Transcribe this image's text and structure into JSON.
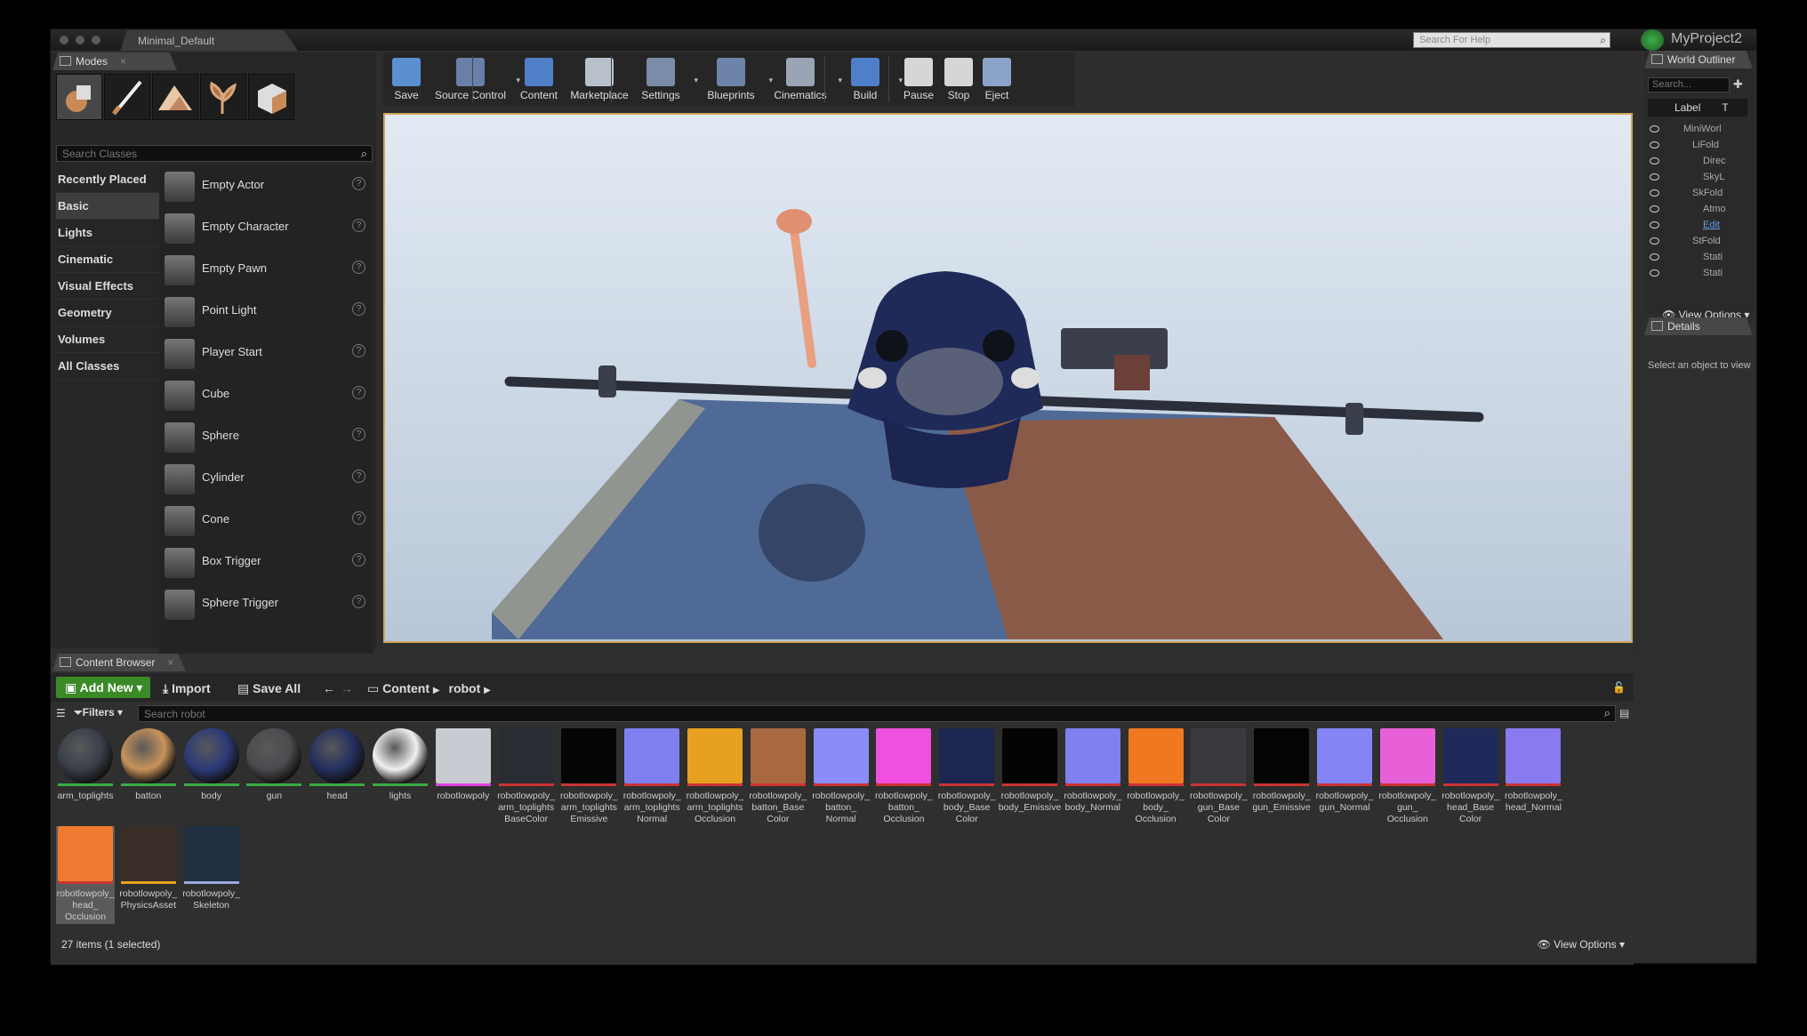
{
  "title_bar": {
    "map_tab": "Minimal_Default",
    "help_search_placeholder": "Search For Help",
    "project_name": "MyProject2"
  },
  "modes": {
    "tab_label": "Modes",
    "search_placeholder": "Search Classes",
    "mode_icons": [
      "place-mode-icon",
      "paint-mode-icon",
      "landscape-mode-icon",
      "foliage-mode-icon",
      "geometry-mode-icon"
    ],
    "categories": [
      "Recently Placed",
      "Basic",
      "Lights",
      "Cinematic",
      "Visual Effects",
      "Geometry",
      "Volumes",
      "All Classes"
    ],
    "selected_category": "Basic",
    "items": [
      "Empty Actor",
      "Empty Character",
      "Empty Pawn",
      "Point Light",
      "Player Start",
      "Cube",
      "Sphere",
      "Cylinder",
      "Cone",
      "Box Trigger",
      "Sphere Trigger"
    ]
  },
  "toolbar": [
    {
      "label": "Save",
      "icon": "save-icon",
      "dropdown": false,
      "color": "#5a8fd0"
    },
    {
      "label": "Source Control",
      "icon": "source-control-icon",
      "dropdown": true,
      "color": "#6a7fa8"
    },
    {
      "label": "Content",
      "icon": "content-icon",
      "dropdown": false,
      "color": "#4f7fc8"
    },
    {
      "label": "Marketplace",
      "icon": "marketplace-icon",
      "dropdown": false,
      "color": "#b8c0cc"
    },
    {
      "label": "Settings",
      "icon": "settings-icon",
      "dropdown": true,
      "color": "#7a8ca8"
    },
    {
      "label": "Blueprints",
      "icon": "blueprints-icon",
      "dropdown": true,
      "color": "#6d83a8"
    },
    {
      "label": "Cinematics",
      "icon": "cinematics-icon",
      "dropdown": true,
      "color": "#9aa4b2"
    },
    {
      "label": "Build",
      "icon": "build-icon",
      "dropdown": true,
      "color": "#4f7fc8"
    },
    {
      "label": "Pause",
      "icon": "pause-icon",
      "dropdown": false,
      "color": "#d6d6d6"
    },
    {
      "label": "Stop",
      "icon": "stop-icon",
      "dropdown": false,
      "color": "#d6d6d6"
    },
    {
      "label": "Eject",
      "icon": "eject-icon",
      "dropdown": false,
      "color": "#8aa3c8"
    }
  ],
  "world_outliner": {
    "tab_label": "World Outliner",
    "search_placeholder": "Search...",
    "col_label": "Label",
    "col_type": "T",
    "rows": [
      "MiniWorl",
      "LiFold",
      "Direc",
      "SkyL",
      "SkFold",
      "Atmo",
      "Edit",
      "StFold",
      "Stati",
      "Stati"
    ],
    "view_options": "View Options"
  },
  "details": {
    "tab_label": "Details",
    "message": "Select an object to view"
  },
  "content_browser": {
    "tab_label": "Content Browser",
    "add_new": "Add New",
    "import": "Import",
    "save_all": "Save All",
    "path": [
      "Content",
      "robot"
    ],
    "filters": "Filters",
    "search_placeholder": "Search robot",
    "assets": [
      {
        "name": "arm_toplights",
        "color": "#3a3f4a",
        "bar": "#3aaa44"
      },
      {
        "name": "batton",
        "color": "#c8935a",
        "bar": "#3aaa44"
      },
      {
        "name": "body",
        "color": "#2c3a78",
        "bar": "#3aaa44"
      },
      {
        "name": "gun",
        "color": "#4c4c50",
        "bar": "#3aaa44"
      },
      {
        "name": "head",
        "color": "#253060",
        "bar": "#3aaa44"
      },
      {
        "name": "lights",
        "color": "#f0f0f0",
        "bar": "#3aaa44"
      },
      {
        "name": "robotlowpoly",
        "color": "#c8ccd2",
        "bar": "#e040e0"
      },
      {
        "name": "robotlowpoly_\narm_toplights\nBaseColor",
        "color": "#2a2e34",
        "bar": "#c33"
      },
      {
        "name": "robotlowpoly_\narm_toplights\nEmissive",
        "color": "#050505",
        "bar": "#c33"
      },
      {
        "name": "robotlowpoly_\narm_toplights\nNormal",
        "color": "#7f7ff0",
        "bar": "#c33"
      },
      {
        "name": "robotlowpoly_\narm_toplights\nOcclusion",
        "color": "#e8a020",
        "bar": "#c33"
      },
      {
        "name": "robotlowpoly_\nbatton_Base\nColor",
        "color": "#a86840",
        "bar": "#c33"
      },
      {
        "name": "robotlowpoly_\nbatton_\nNormal",
        "color": "#8c8cf8",
        "bar": "#c33"
      },
      {
        "name": "robotlowpoly_\nbatton_\nOcclusion",
        "color": "#f050e0",
        "bar": "#c33"
      },
      {
        "name": "robotlowpoly_\nbody_Base\nColor",
        "color": "#1c2650",
        "bar": "#c33"
      },
      {
        "name": "robotlowpoly_\nbody_Emissive",
        "color": "#030303",
        "bar": "#c33"
      },
      {
        "name": "robotlowpoly_\nbody_Normal",
        "color": "#8080f0",
        "bar": "#c33"
      },
      {
        "name": "robotlowpoly_\nbody_\nOcclusion",
        "color": "#f07820",
        "bar": "#c33"
      },
      {
        "name": "robotlowpoly_\ngun_Base\nColor",
        "color": "#3a3a3e",
        "bar": "#c33"
      },
      {
        "name": "robotlowpoly_\ngun_Emissive",
        "color": "#040404",
        "bar": "#c33"
      },
      {
        "name": "robotlowpoly_\ngun_Normal",
        "color": "#8484f4",
        "bar": "#c33"
      },
      {
        "name": "robotlowpoly_\ngun_\nOcclusion",
        "color": "#e860d8",
        "bar": "#c33"
      },
      {
        "name": "robotlowpoly_\nhead_Base\nColor",
        "color": "#202a5a",
        "bar": "#c33"
      },
      {
        "name": "robotlowpoly_\nhead_Normal",
        "color": "#8a7af0",
        "bar": "#c33"
      },
      {
        "name": "robotlowpoly_\nhead_\nOcclusion",
        "color": "#f07a30",
        "bar": "#c33"
      },
      {
        "name": "robotlowpoly_\nPhysicsAsset",
        "color": "#3a2e28",
        "bar": "#e8a020"
      },
      {
        "name": "robotlowpoly_\nSkeleton",
        "color": "#203040",
        "bar": "#9ad"
      }
    ],
    "selected_asset": "robotlowpoly_\nhead_\nOcclusion",
    "item_count": "27 items (1 selected)",
    "view_options": "View Options"
  }
}
